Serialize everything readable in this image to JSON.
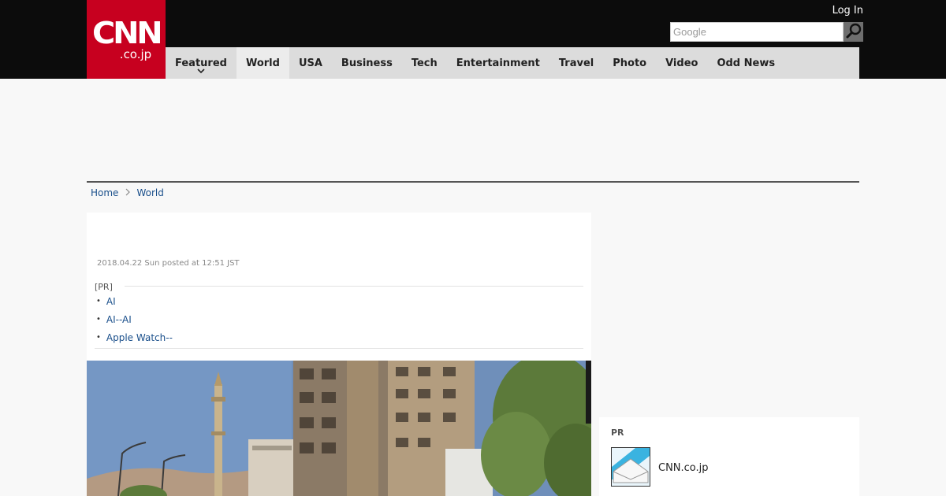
{
  "header": {
    "logo_mark": "CNN",
    "logo_sub": ".co.jp",
    "login_label": "Log In",
    "search_placeholder": "Google"
  },
  "nav": {
    "items": [
      {
        "label": "Featured"
      },
      {
        "label": "World"
      },
      {
        "label": "USA"
      },
      {
        "label": "Business"
      },
      {
        "label": "Tech"
      },
      {
        "label": "Entertainment"
      },
      {
        "label": "Travel"
      },
      {
        "label": "Photo"
      },
      {
        "label": "Video"
      },
      {
        "label": "Odd News"
      }
    ],
    "active": "World"
  },
  "breadcrumb": {
    "home": "Home",
    "current": "World"
  },
  "article": {
    "posted": "2018.04.22 Sun posted at 12:51 JST",
    "pr_label": "[PR]",
    "pr_links": [
      "AI",
      "AI--AI",
      "Apple Watch--"
    ]
  },
  "sidebar": {
    "pr_label": "PR",
    "pr_name": "CNN.co.jp"
  },
  "colors": {
    "brand": "#c7001f",
    "topbar": "#0c0c0c",
    "nav_bg": "#dcdcdc",
    "link": "#1a4f8b"
  }
}
